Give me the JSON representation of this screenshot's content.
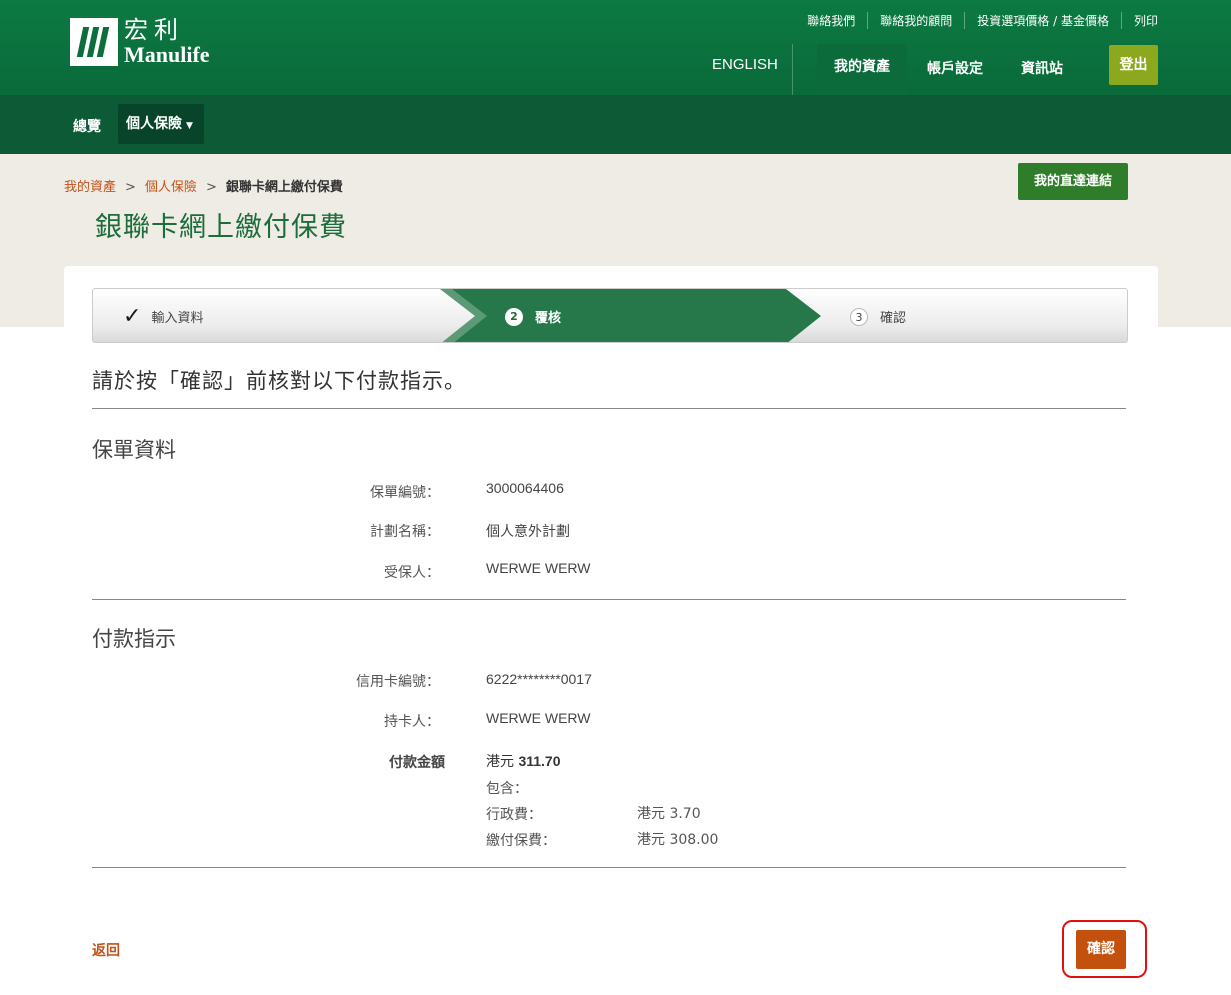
{
  "brand": {
    "name_cn": "宏利",
    "name_en": "Manulife"
  },
  "header": {
    "utility_links": [
      "聯絡我們",
      "聯絡我的顧問",
      "投資選項價格 / 基金價格",
      "列印"
    ],
    "language": "ENGLISH",
    "nav": {
      "my_assets": "我的資產",
      "account_settings": "帳戶設定",
      "info_station": "資訊站"
    },
    "logout": "登出"
  },
  "subnav": {
    "overview": "總覽",
    "personal_insurance": "個人保險"
  },
  "breadcrumb": {
    "items": [
      "我的資產",
      "個人保險"
    ],
    "separator": ">",
    "current": "銀聯卡網上繳付保費"
  },
  "quick_links_button": "我的直達連結",
  "page_title": "銀聯卡網上繳付保費",
  "steps": [
    {
      "label": "輸入資料",
      "state": "done",
      "marker": "✓"
    },
    {
      "label": "覆核",
      "state": "active",
      "marker": "2"
    },
    {
      "label": "確認",
      "state": "pending",
      "marker": "3"
    }
  ],
  "instruction": "請於按「確認」前核對以下付款指示。",
  "policy_section": {
    "title": "保單資料",
    "policy_no_label": "保單編號：",
    "policy_no": "3000064406",
    "plan_name_label": "計劃名稱：",
    "plan_name": "個人意外計劃",
    "insured_label": "受保人：",
    "insured": "WERWE WERW"
  },
  "payment_section": {
    "title": "付款指示",
    "card_no_label": "信用卡編號：",
    "card_no": "6222********0017",
    "cardholder_label": "持卡人：",
    "cardholder": "WERWE WERW",
    "amount_label": "付款金額",
    "amount_currency": "港元",
    "amount_value": "311.70",
    "includes_label": "包含：",
    "admin_fee_label": "行政費：",
    "admin_fee": "港元 3.70",
    "premium_label": "繳付保費：",
    "premium": "港元 308.00"
  },
  "actions": {
    "back": "返回",
    "confirm": "確認"
  },
  "colors": {
    "header_green": "#0c7a42",
    "subnav_green": "#0d5b36",
    "link_orange": "#c2521a",
    "confirm_orange": "#c4500e",
    "logout_olive": "#8ba81f",
    "highlight_red": "#e01010"
  }
}
